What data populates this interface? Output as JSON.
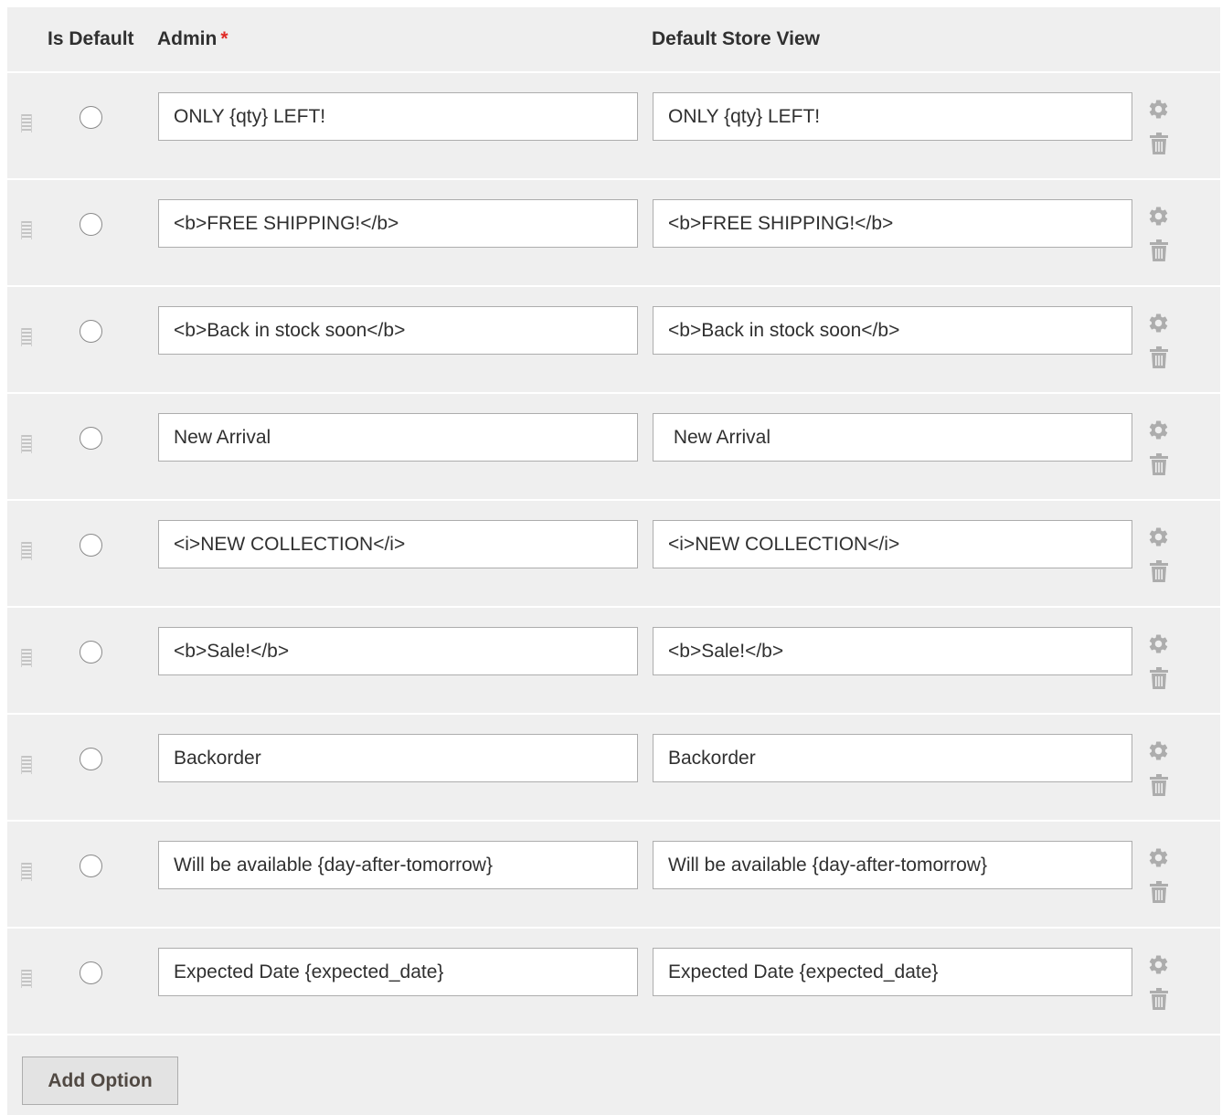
{
  "header": {
    "is_default": "Is Default",
    "admin": "Admin",
    "required_marker": "*",
    "store_view": "Default Store View"
  },
  "options": [
    {
      "admin": "ONLY {qty} LEFT!",
      "store_view": "ONLY {qty} LEFT!",
      "is_default": false
    },
    {
      "admin": "<b>FREE SHIPPING!</b>",
      "store_view": "<b>FREE SHIPPING!</b>",
      "is_default": false
    },
    {
      "admin": "<b>Back in stock soon</b>",
      "store_view": "<b>Back in stock soon</b>",
      "is_default": false
    },
    {
      "admin": "New Arrival",
      "store_view": " New Arrival",
      "is_default": false
    },
    {
      "admin": "<i>NEW COLLECTION</i>",
      "store_view": "<i>NEW COLLECTION</i>",
      "is_default": false
    },
    {
      "admin": "<b>Sale!</b>",
      "store_view": "<b>Sale!</b>",
      "is_default": false
    },
    {
      "admin": "Backorder",
      "store_view": "Backorder",
      "is_default": false
    },
    {
      "admin": "Will be available {day-after-tomorrow}",
      "store_view": "Will be available {day-after-tomorrow}",
      "is_default": false
    },
    {
      "admin": "Expected Date {expected_date}",
      "store_view": "Expected Date {expected_date}",
      "is_default": false
    }
  ],
  "icons": {
    "drag": "drag-handle-icon",
    "settings": "gear-icon",
    "delete": "trash-icon"
  },
  "colors": {
    "panel_background": "#efefef",
    "required": "#e02b27",
    "icon": "#adadad"
  },
  "add_option_label": "Add Option"
}
